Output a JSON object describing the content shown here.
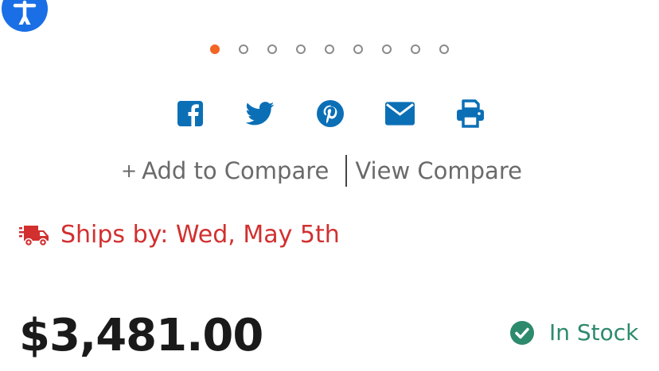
{
  "carousel": {
    "total": 9,
    "active_index": 0,
    "colors": {
      "active": "#f26522",
      "inactive": "#8a8a8a"
    }
  },
  "share": {
    "icons": [
      "facebook-icon",
      "twitter-icon",
      "pinterest-icon",
      "email-icon",
      "print-icon"
    ],
    "color": "#0b6fb6"
  },
  "compare": {
    "add_label": "Add to Compare",
    "view_label": "View Compare"
  },
  "shipping": {
    "text": "Ships by: Wed, May 5th",
    "color": "#d1302f"
  },
  "product": {
    "price": "$3,481.00",
    "stock_status": "In Stock",
    "stock_color": "#2d8a6d"
  },
  "accessibility": {
    "color": "#1a6fe6"
  }
}
